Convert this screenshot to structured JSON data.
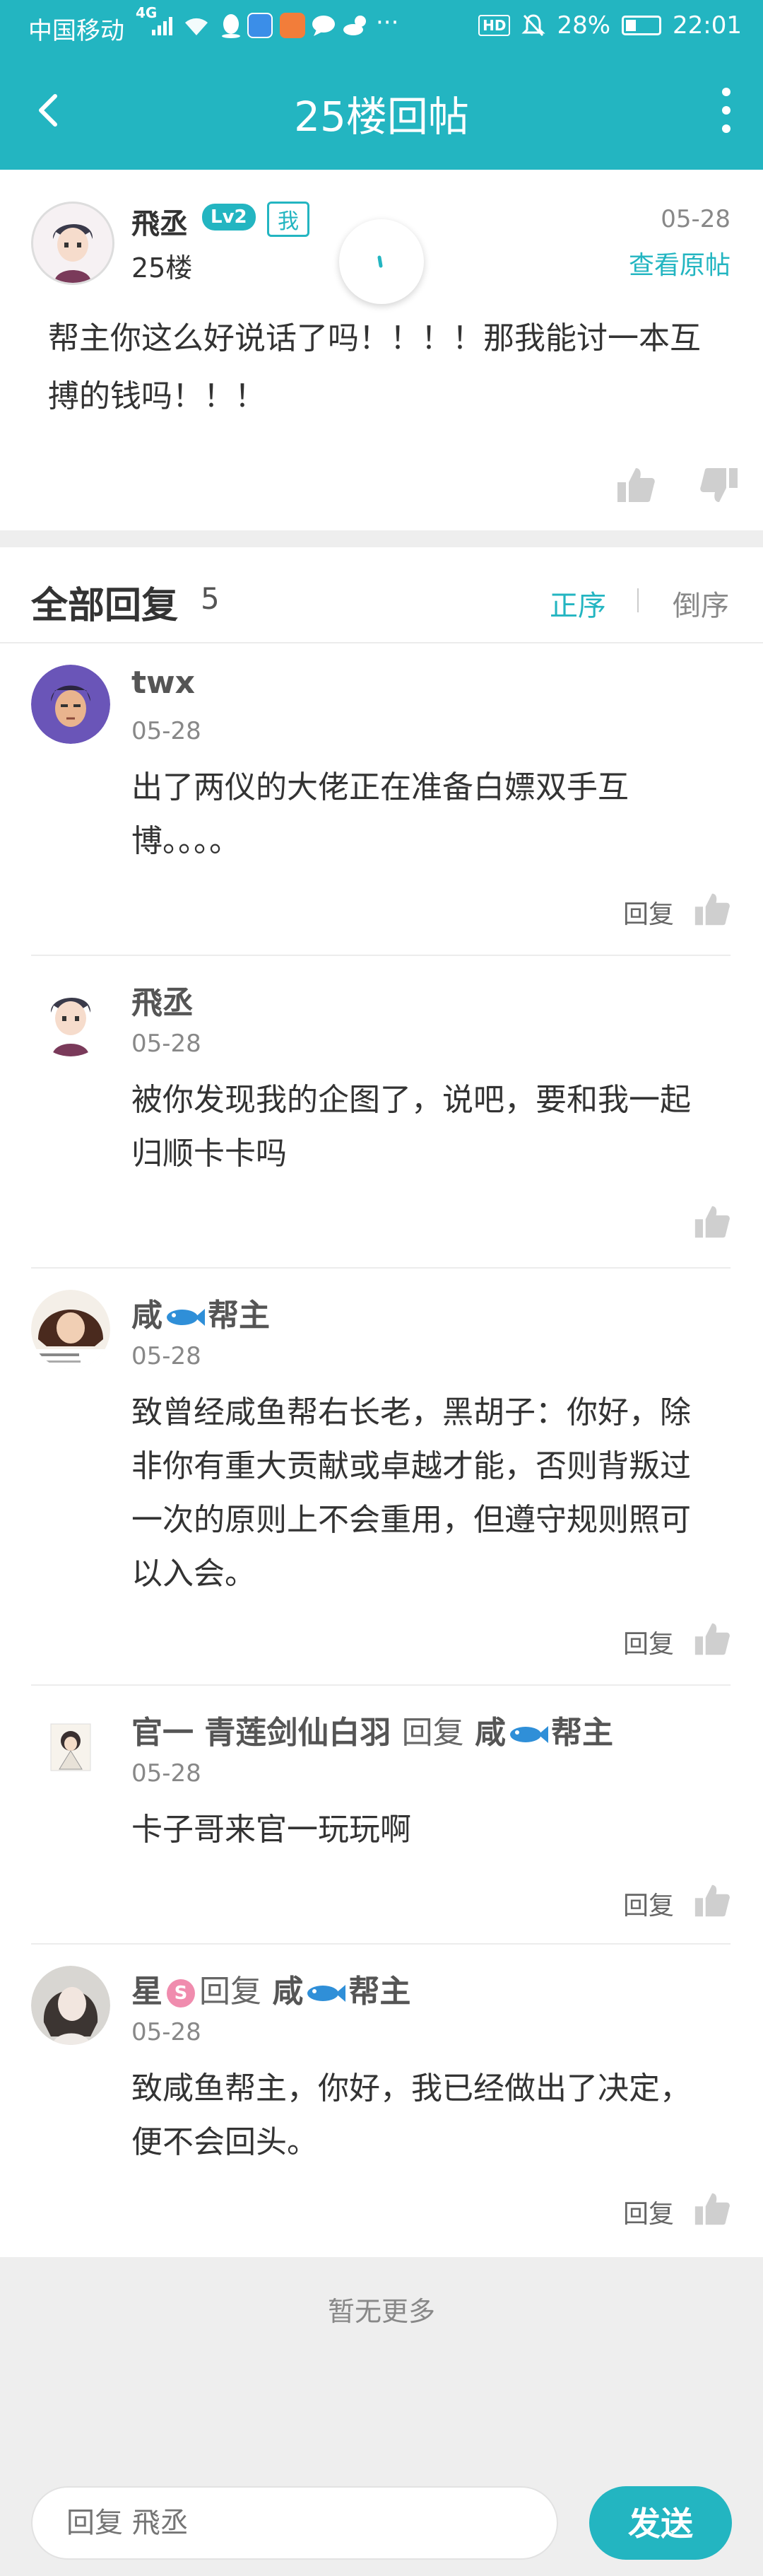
{
  "status_bar": {
    "carrier": "中国移动",
    "network": "4G",
    "hd_label": "HD",
    "battery": "28%",
    "time": "22:01",
    "icons": [
      "wifi-icon",
      "qq-icon",
      "app-icon",
      "video-icon",
      "chat-icon",
      "weather-icon",
      "more-dots-icon",
      "mute-icon"
    ]
  },
  "header": {
    "title": "25楼回帖",
    "back_icon": "back-arrow-icon",
    "more_icon": "more-vertical-icon"
  },
  "post": {
    "author": "飛丞",
    "level": "Lv2",
    "me_badge": "我",
    "floor": "25楼",
    "date": "05-28",
    "view_original": "查看原帖",
    "content": "帮主你这么好说话了吗！！！！那我能讨一本互搏的钱吗！！！"
  },
  "replies_section": {
    "title": "全部回复",
    "count": "5",
    "sort_asc": "正序",
    "sort_desc": "倒序",
    "reply_label": "回复"
  },
  "replies": [
    {
      "name": "twx",
      "date": "05-28",
      "text": "出了两仪的大佬正在准备白嫖双手互博。。。。",
      "show_reply": true
    },
    {
      "name": "飛丞",
      "date": "05-28",
      "text": "被你发现我的企图了，说吧，要和我一起归顺卡卡吗",
      "show_reply": false
    },
    {
      "name_a": "咸",
      "name_b": "帮主",
      "date": "05-28",
      "text": "致曾经咸鱼帮右长老，黑胡子：你好，除非你有重大贡献或卓越才能，否则背叛过一次的原则上不会重用，但遵守规则照可以入会。",
      "show_reply": true
    },
    {
      "name": "官一 青莲剑仙白羽",
      "reply_word": "回复",
      "target_a": "咸",
      "target_b": "帮主",
      "date": "05-28",
      "text": "卡子哥来官一玩玩啊",
      "show_reply": true
    },
    {
      "name": "星",
      "badge": "S",
      "reply_word": "回复",
      "target_a": "咸",
      "target_b": "帮主",
      "date": "05-28",
      "text": "致咸鱼帮主，你好，我已经做出了决定，便不会回头。",
      "show_reply": true
    }
  ],
  "footer": {
    "no_more": "暂无更多",
    "input_placeholder": "回复 飛丞",
    "send": "发送"
  },
  "colors": {
    "accent": "#23b5c1",
    "text": "#333333",
    "muted": "#888888",
    "background_gray": "#eeeeee"
  }
}
